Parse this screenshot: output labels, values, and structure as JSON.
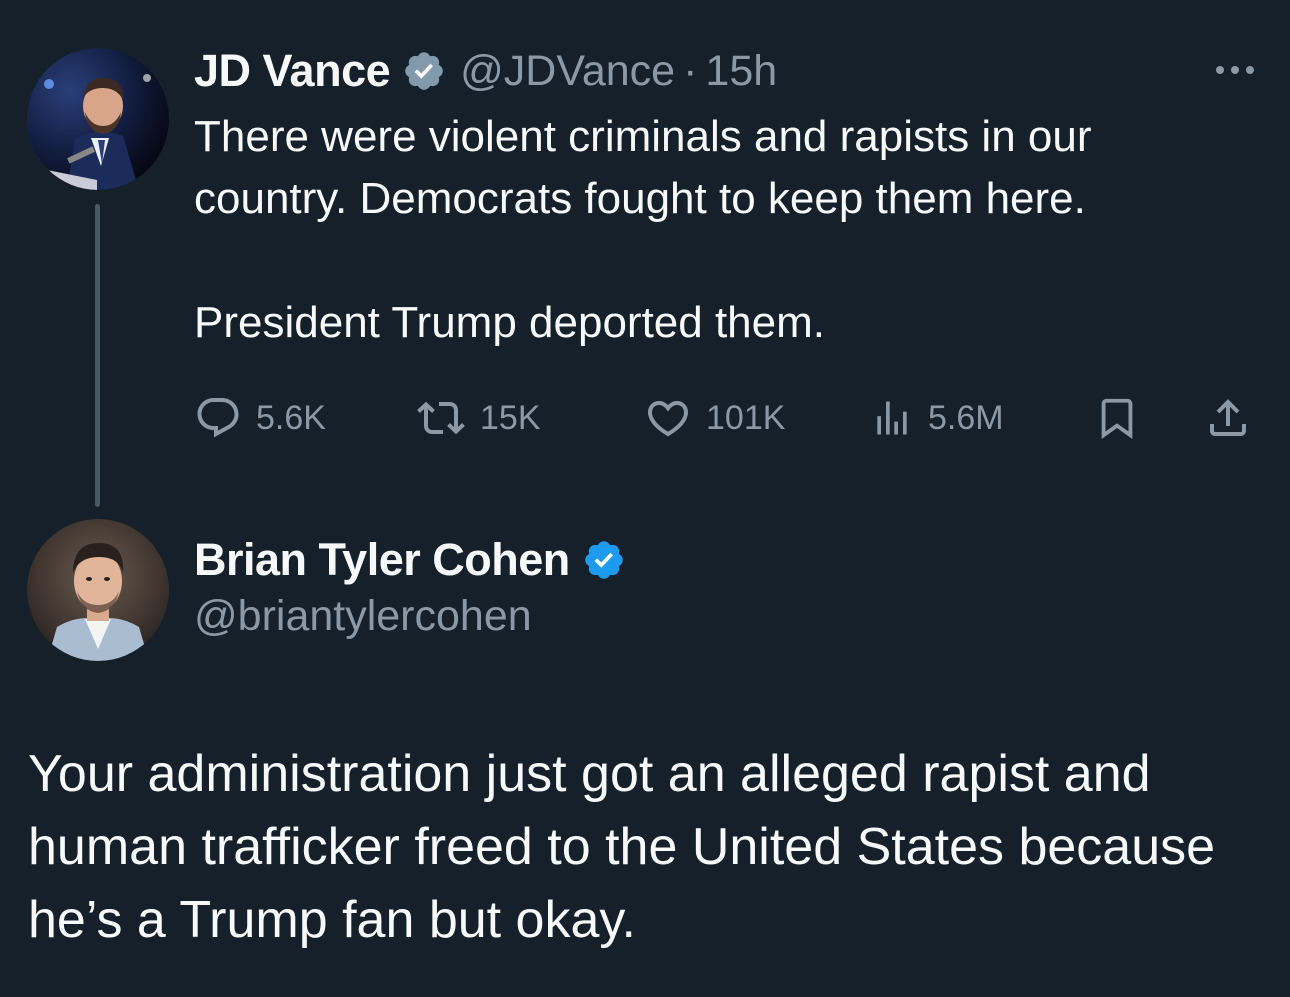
{
  "colors": {
    "background": "#15202b",
    "text_primary": "#f7f9f9",
    "text_secondary": "#8b98a5",
    "verified_blue": "#1d9bf0",
    "verified_gray": "#829aab",
    "thread_line": "#4a5863"
  },
  "original_post": {
    "author": {
      "name": "JD Vance",
      "handle": "@JDVance",
      "verified_badge": "gray-verified-icon",
      "avatar": "avatar"
    },
    "separator": "·",
    "timestamp": "15h",
    "text": [
      "There were violent criminals and rapists in our country. Democrats fought to keep them here.",
      "President Trump deported them."
    ],
    "actions": {
      "replies": {
        "icon": "reply-icon",
        "count": "5.6K"
      },
      "reposts": {
        "icon": "retweet-icon",
        "count": "15K"
      },
      "likes": {
        "icon": "heart-icon",
        "count": "101K"
      },
      "views": {
        "icon": "views-icon",
        "count": "5.6M"
      },
      "bookmark": {
        "icon": "bookmark-icon"
      },
      "share": {
        "icon": "share-icon"
      }
    },
    "more_icon": "more-icon"
  },
  "reply_post": {
    "author": {
      "name": "Brian Tyler Cohen",
      "handle": "@briantylercohen",
      "verified_badge": "blue-verified-icon",
      "avatar": "avatar"
    },
    "text": "Your administration just got an alleged rapist and human trafficker freed to the United States because he’s a Trump fan but okay."
  }
}
